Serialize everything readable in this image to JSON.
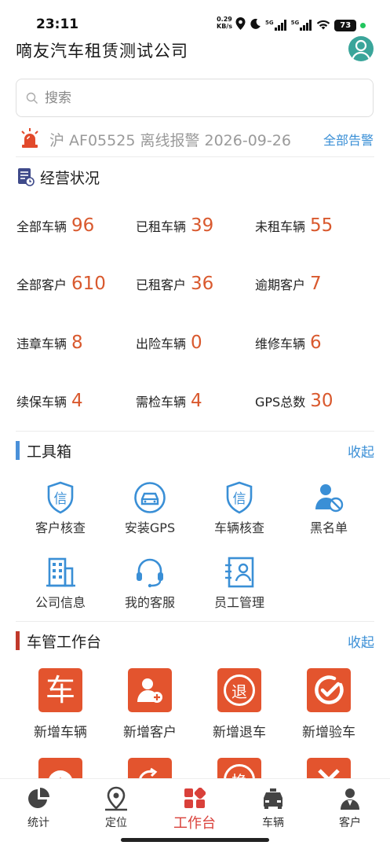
{
  "status_bar": {
    "time": "23:11",
    "net_speed_value": "0.29",
    "net_speed_unit": "KB/s",
    "signal_1": "5G",
    "signal_2": "5G",
    "battery": "73",
    "icons": [
      "location-icon",
      "moon-icon",
      "signal-icon",
      "signal-icon",
      "wifi-icon",
      "battery-icon"
    ]
  },
  "header": {
    "company_name": "嘀友汽车租赁测试公司",
    "avatar_icon": "user-avatar-icon"
  },
  "search": {
    "placeholder": "搜索",
    "icon": "search-icon"
  },
  "alarm": {
    "message": "沪 AF05525 离线报警 2026-09-26",
    "all_alarms_label": "全部告警",
    "icon": "siren-icon"
  },
  "operations": {
    "title": "经营状况",
    "icon": "report-icon",
    "stats": [
      {
        "label": "全部车辆",
        "value": "96"
      },
      {
        "label": "已租车辆",
        "value": "39"
      },
      {
        "label": "未租车辆",
        "value": "55"
      },
      {
        "label": "全部客户",
        "value": "610"
      },
      {
        "label": "已租客户",
        "value": "36"
      },
      {
        "label": "逾期客户",
        "value": "7"
      },
      {
        "label": "违章车辆",
        "value": "8"
      },
      {
        "label": "出险车辆",
        "value": "0"
      },
      {
        "label": "维修车辆",
        "value": "6"
      },
      {
        "label": "续保车辆",
        "value": "4"
      },
      {
        "label": "需检车辆",
        "value": "4"
      },
      {
        "label": "GPS总数",
        "value": "30"
      }
    ]
  },
  "toolbox": {
    "title": "工具箱",
    "collapse_label": "收起",
    "accent_color": "#4a90d9",
    "items": [
      {
        "label": "客户核查",
        "icon": "shield-credit-icon"
      },
      {
        "label": "安装GPS",
        "icon": "car-gps-icon"
      },
      {
        "label": "车辆核查",
        "icon": "shield-credit-icon"
      },
      {
        "label": "黑名单",
        "icon": "user-blocked-icon"
      },
      {
        "label": "公司信息",
        "icon": "building-icon"
      },
      {
        "label": "我的客服",
        "icon": "headset-icon"
      },
      {
        "label": "员工管理",
        "icon": "id-card-icon"
      }
    ]
  },
  "fleet_workbench": {
    "title": "车管工作台",
    "collapse_label": "收起",
    "accent_color": "#c0392b",
    "tile_color": "#e3542e",
    "items": [
      {
        "label": "新增车辆",
        "icon": "car-char-icon",
        "glyph": "车"
      },
      {
        "label": "新增客户",
        "icon": "add-customer-icon"
      },
      {
        "label": "新增退车",
        "icon": "return-car-icon",
        "glyph": "退"
      },
      {
        "label": "新增验车",
        "icon": "inspect-car-icon"
      },
      {
        "label": "",
        "icon": "up-arrow-icon"
      },
      {
        "label": "",
        "icon": "refresh-icon"
      },
      {
        "label": "",
        "icon": "swap-icon",
        "glyph": "换"
      },
      {
        "label": "",
        "icon": "wrench-icon"
      }
    ]
  },
  "tab_bar": {
    "active_color": "#d9403a",
    "tabs": [
      {
        "label": "统计",
        "icon": "pie-chart-icon"
      },
      {
        "label": "定位",
        "icon": "map-pin-icon"
      },
      {
        "label": "工作台",
        "icon": "workbench-icon",
        "active": true
      },
      {
        "label": "车辆",
        "icon": "car-icon"
      },
      {
        "label": "客户",
        "icon": "customer-icon"
      }
    ]
  }
}
